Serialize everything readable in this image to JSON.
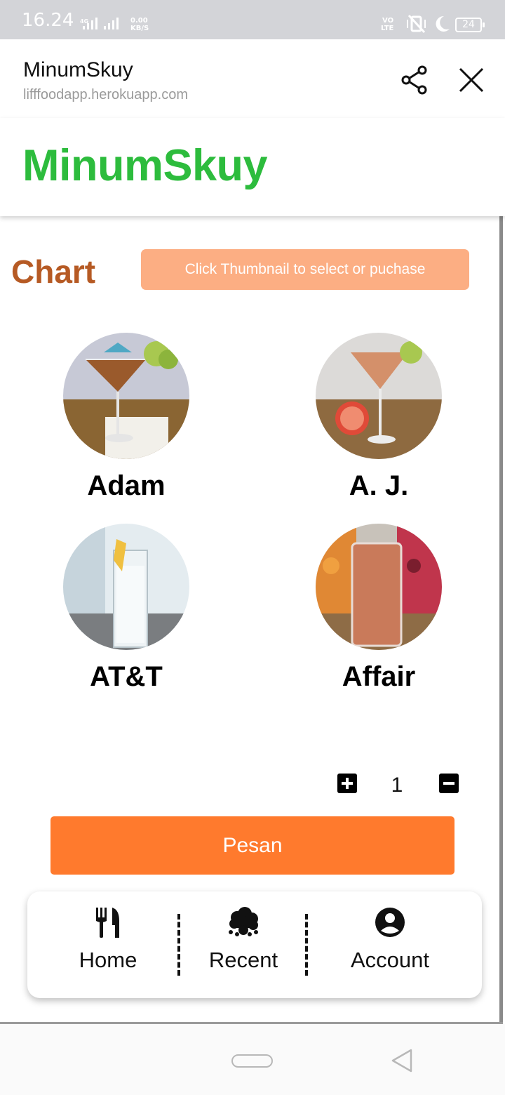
{
  "status_bar": {
    "time": "16.24",
    "network_label": "4G",
    "speed_value": "0.00",
    "speed_unit": "KB/S",
    "volte_label_1": "VO",
    "volte_label_2": "LTE",
    "battery": "24"
  },
  "liff": {
    "title": "MinumSkuy",
    "url": "lifffoodapp.herokuapp.com"
  },
  "brand": {
    "title": "MinumSkuy",
    "color": "#2dbc3d"
  },
  "section": {
    "title": "Chart",
    "hint_button": "Click Thumbnail to select or puchase"
  },
  "products": [
    {
      "name": "Adam"
    },
    {
      "name": "A. J."
    },
    {
      "name": "AT&T"
    },
    {
      "name": "Affair"
    }
  ],
  "quantity": {
    "value": "1"
  },
  "order_button": "Pesan",
  "nav": [
    {
      "label": "Home",
      "icon": "fork-knife-icon"
    },
    {
      "label": "Recent",
      "icon": "cloud-icon"
    },
    {
      "label": "Account",
      "icon": "account-circle-icon"
    }
  ],
  "colors": {
    "accent_orange": "#ff7a2d",
    "hint_orange": "#fcae83",
    "section_brown": "#b65a24"
  }
}
